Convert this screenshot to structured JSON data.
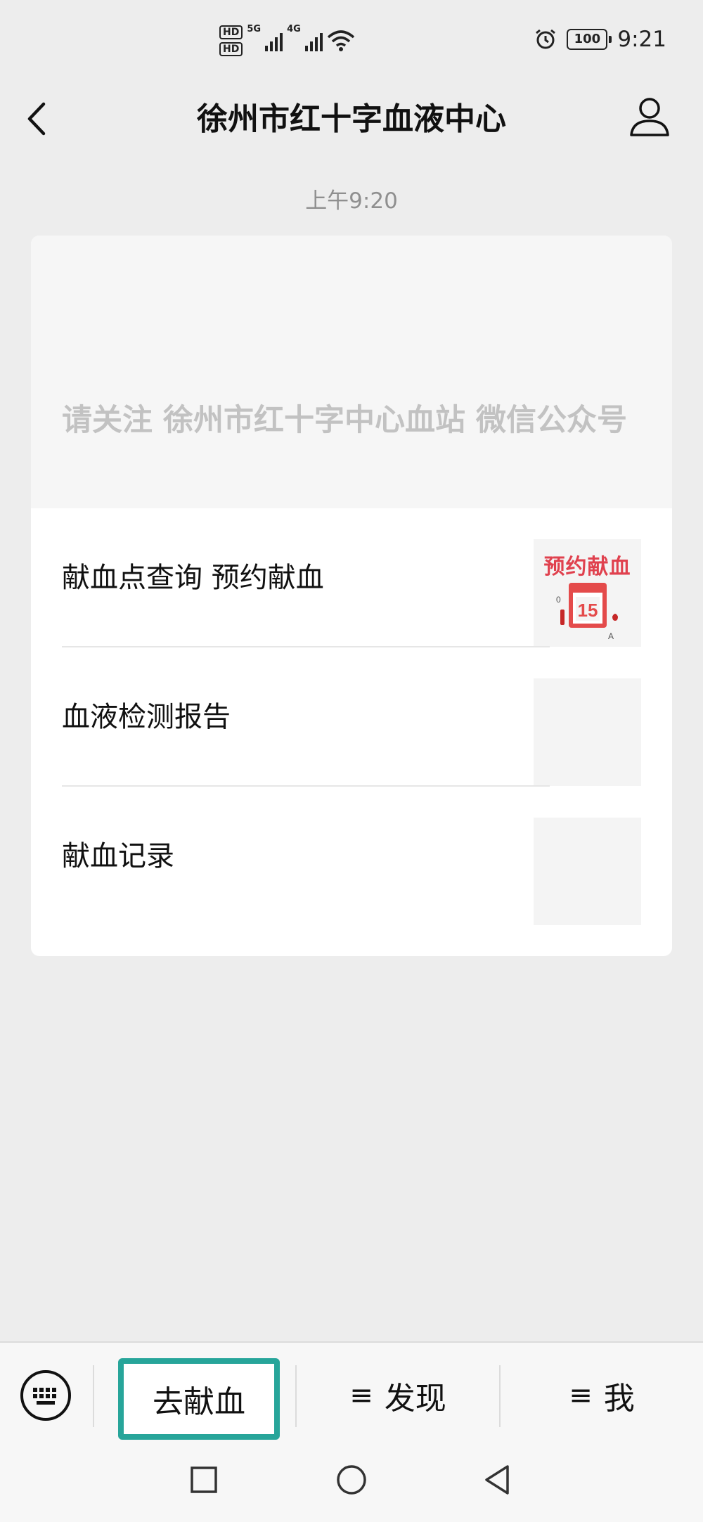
{
  "status_bar": {
    "sim1_label": "HD",
    "sim2_label": "HD",
    "net1": "5G",
    "net2": "4G",
    "battery": "100",
    "time": "9:21",
    "icons": [
      "signal-icon",
      "wifi-icon",
      "alarm-icon",
      "battery-icon"
    ]
  },
  "nav": {
    "title": "徐州市红十字血液中心",
    "back_icon": "back-arrow-icon",
    "profile_icon": "profile-icon"
  },
  "chat": {
    "timestamp": "上午9:20"
  },
  "card": {
    "header_text": "请关注 徐州市红十字中心血站 微信公众号",
    "items": [
      {
        "label": "献血点查询 预约献血",
        "thumb_text": "预约献血"
      },
      {
        "label": "血液检测报告"
      },
      {
        "label": "献血记录"
      }
    ]
  },
  "bottom_menu": {
    "keyboard_icon": "keyboard-icon",
    "items": [
      {
        "label": "去献血",
        "active": true
      },
      {
        "label": "发现",
        "hamburger": "≡"
      },
      {
        "label": "我",
        "hamburger": "≡"
      }
    ]
  },
  "system_nav": {
    "icons": [
      "square-icon",
      "circle-icon",
      "triangle-back-icon"
    ]
  },
  "colors": {
    "background": "#ededed",
    "highlight_border": "#27a59a",
    "promo_red": "#e0414e",
    "promo_bg": "#fbd0d4"
  }
}
